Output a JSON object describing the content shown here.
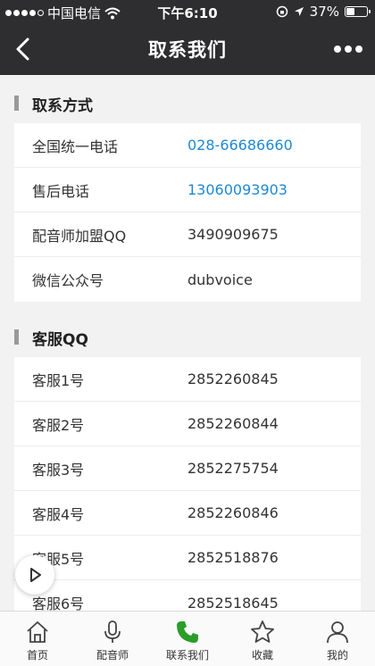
{
  "status": {
    "carrier": "中国电信",
    "time": "下午6:10",
    "battery_text": "37%",
    "battery_level": 0.37
  },
  "nav": {
    "title": "取系我们"
  },
  "sections": {
    "contact": {
      "title": "取系方式",
      "rows": [
        {
          "label": "全国统一电话",
          "value": "028-66686660"
        },
        {
          "label": "售后电话",
          "value": "13060093903"
        },
        {
          "label": "配音师加盟QQ",
          "value": "3490909675"
        },
        {
          "label": "微信公众号",
          "value": "dubvoice"
        }
      ]
    },
    "service": {
      "title": "客服QQ",
      "rows": [
        {
          "label": "客服1号",
          "value": "2852260845"
        },
        {
          "label": "客服2号",
          "value": "2852260844"
        },
        {
          "label": "客服3号",
          "value": "2852275754"
        },
        {
          "label": "客服4号",
          "value": "2852260846"
        },
        {
          "label": "客服5号",
          "value": "2852518876"
        },
        {
          "label": "客服6号",
          "value": "2852518645"
        }
      ]
    }
  },
  "tabs": [
    {
      "label": "首页",
      "icon": "home-icon"
    },
    {
      "label": "配音师",
      "icon": "microphone-icon"
    },
    {
      "label": "联系我们",
      "icon": "phone-icon",
      "active": true
    },
    {
      "label": "收藏",
      "icon": "star-icon"
    },
    {
      "label": "我的",
      "icon": "user-icon"
    }
  ],
  "colors": {
    "header": "#2e2e30",
    "link": "#1e88d3",
    "active_tab": "#2a9d2a"
  }
}
